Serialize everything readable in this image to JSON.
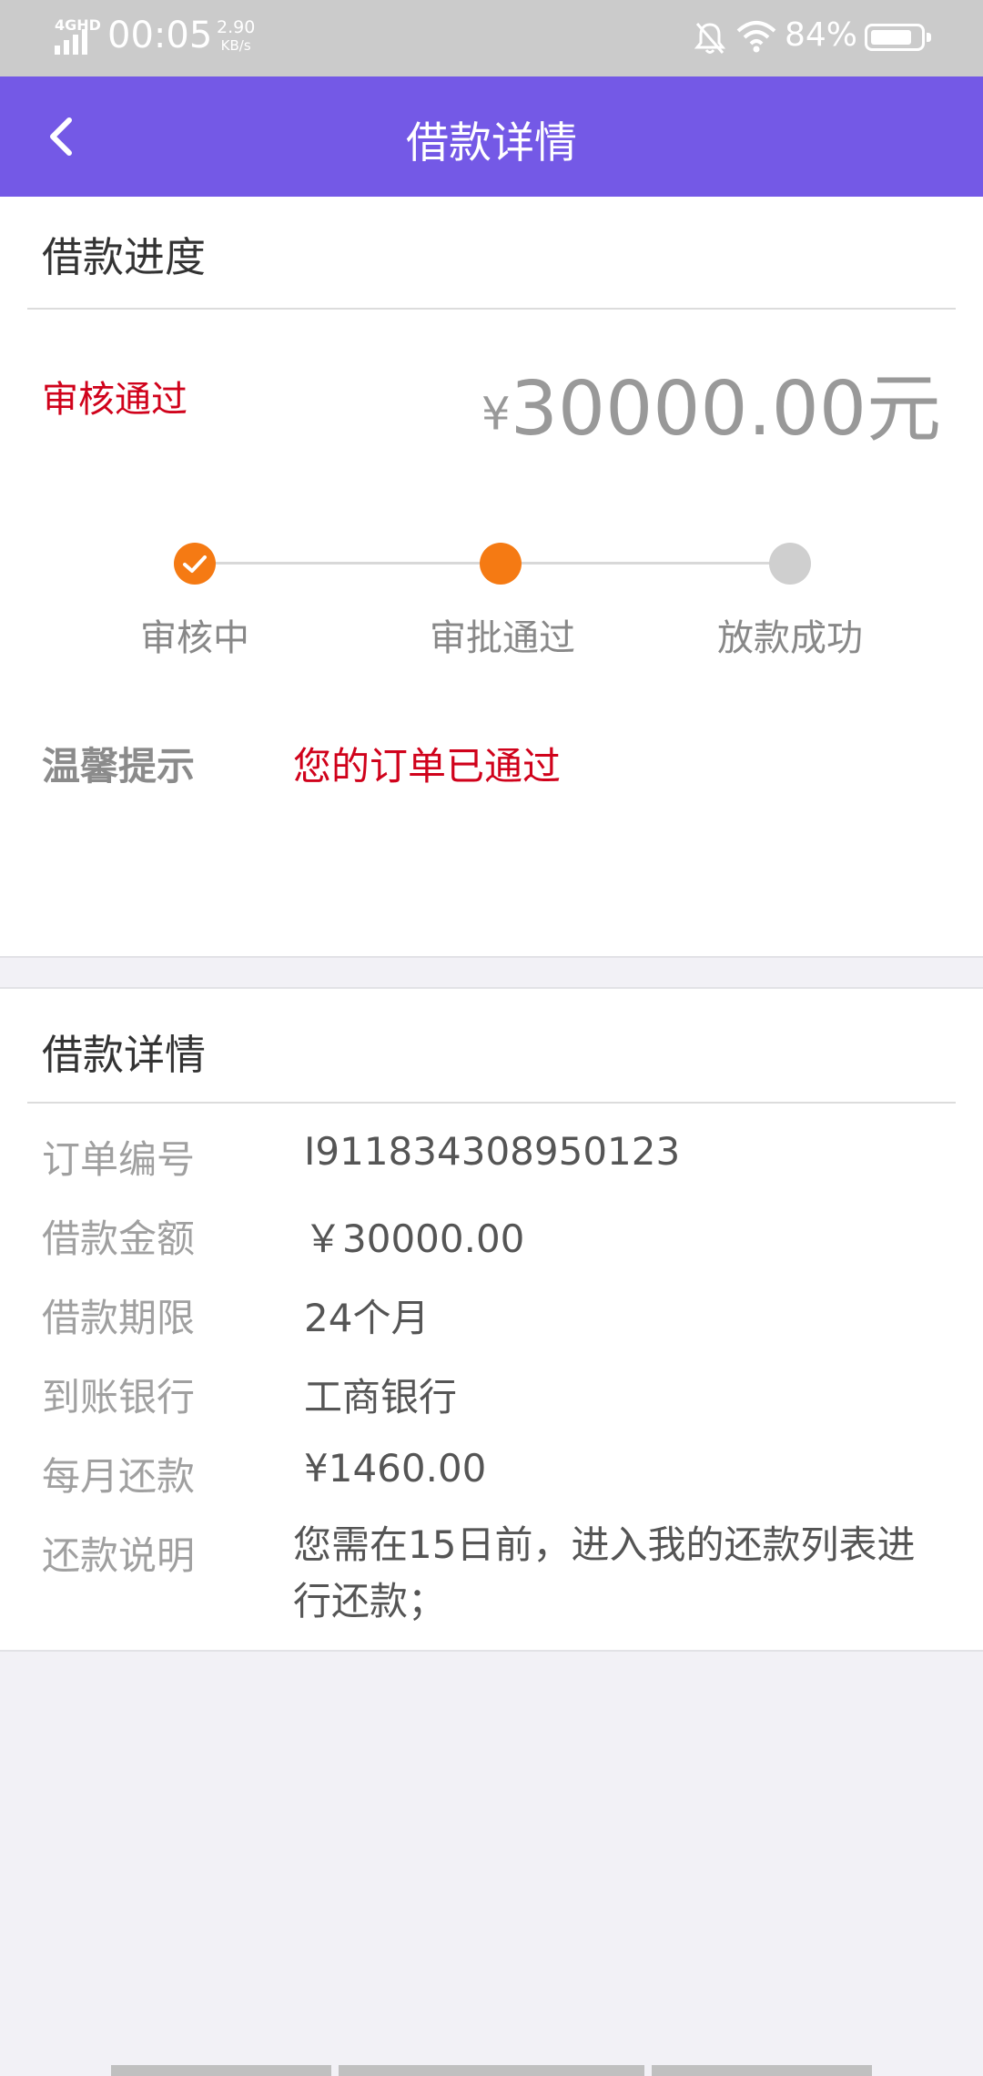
{
  "status_bar": {
    "network": "4GHD",
    "time": "00:05",
    "speed_value": "2.90",
    "speed_unit": "KB/s",
    "battery": "84%",
    "battery_level_percent": 84
  },
  "nav": {
    "title": "借款详情",
    "back_icon": "chevron-left-icon"
  },
  "progress": {
    "section_title": "借款进度",
    "status": "审核通过",
    "amount_symbol": "¥",
    "amount": "30000.00元",
    "steps": [
      {
        "label": "审核中",
        "state": "completed"
      },
      {
        "label": "审批通过",
        "state": "current"
      },
      {
        "label": "放款成功",
        "state": "pending"
      }
    ],
    "tip_label": "温馨提示",
    "tip_text": "您的订单已通过"
  },
  "details": {
    "section_title": "借款详情",
    "rows": [
      {
        "label": "订单编号",
        "value": "I911834308950123"
      },
      {
        "label": "借款金额",
        "value": "￥30000.00"
      },
      {
        "label": "借款期限",
        "value": "24个月"
      },
      {
        "label": "到账银行",
        "value": "工商银行"
      },
      {
        "label": "每月还款",
        "value": "¥1460.00"
      },
      {
        "label": "还款说明",
        "value": "您需在15日前，进入我的还款列表进行还款；"
      }
    ]
  },
  "colors": {
    "nav_bg": "#7459e6",
    "accent_orange": "#f57a13",
    "alert_red": "#d0021b",
    "pending_gray": "#cfcfcf"
  }
}
